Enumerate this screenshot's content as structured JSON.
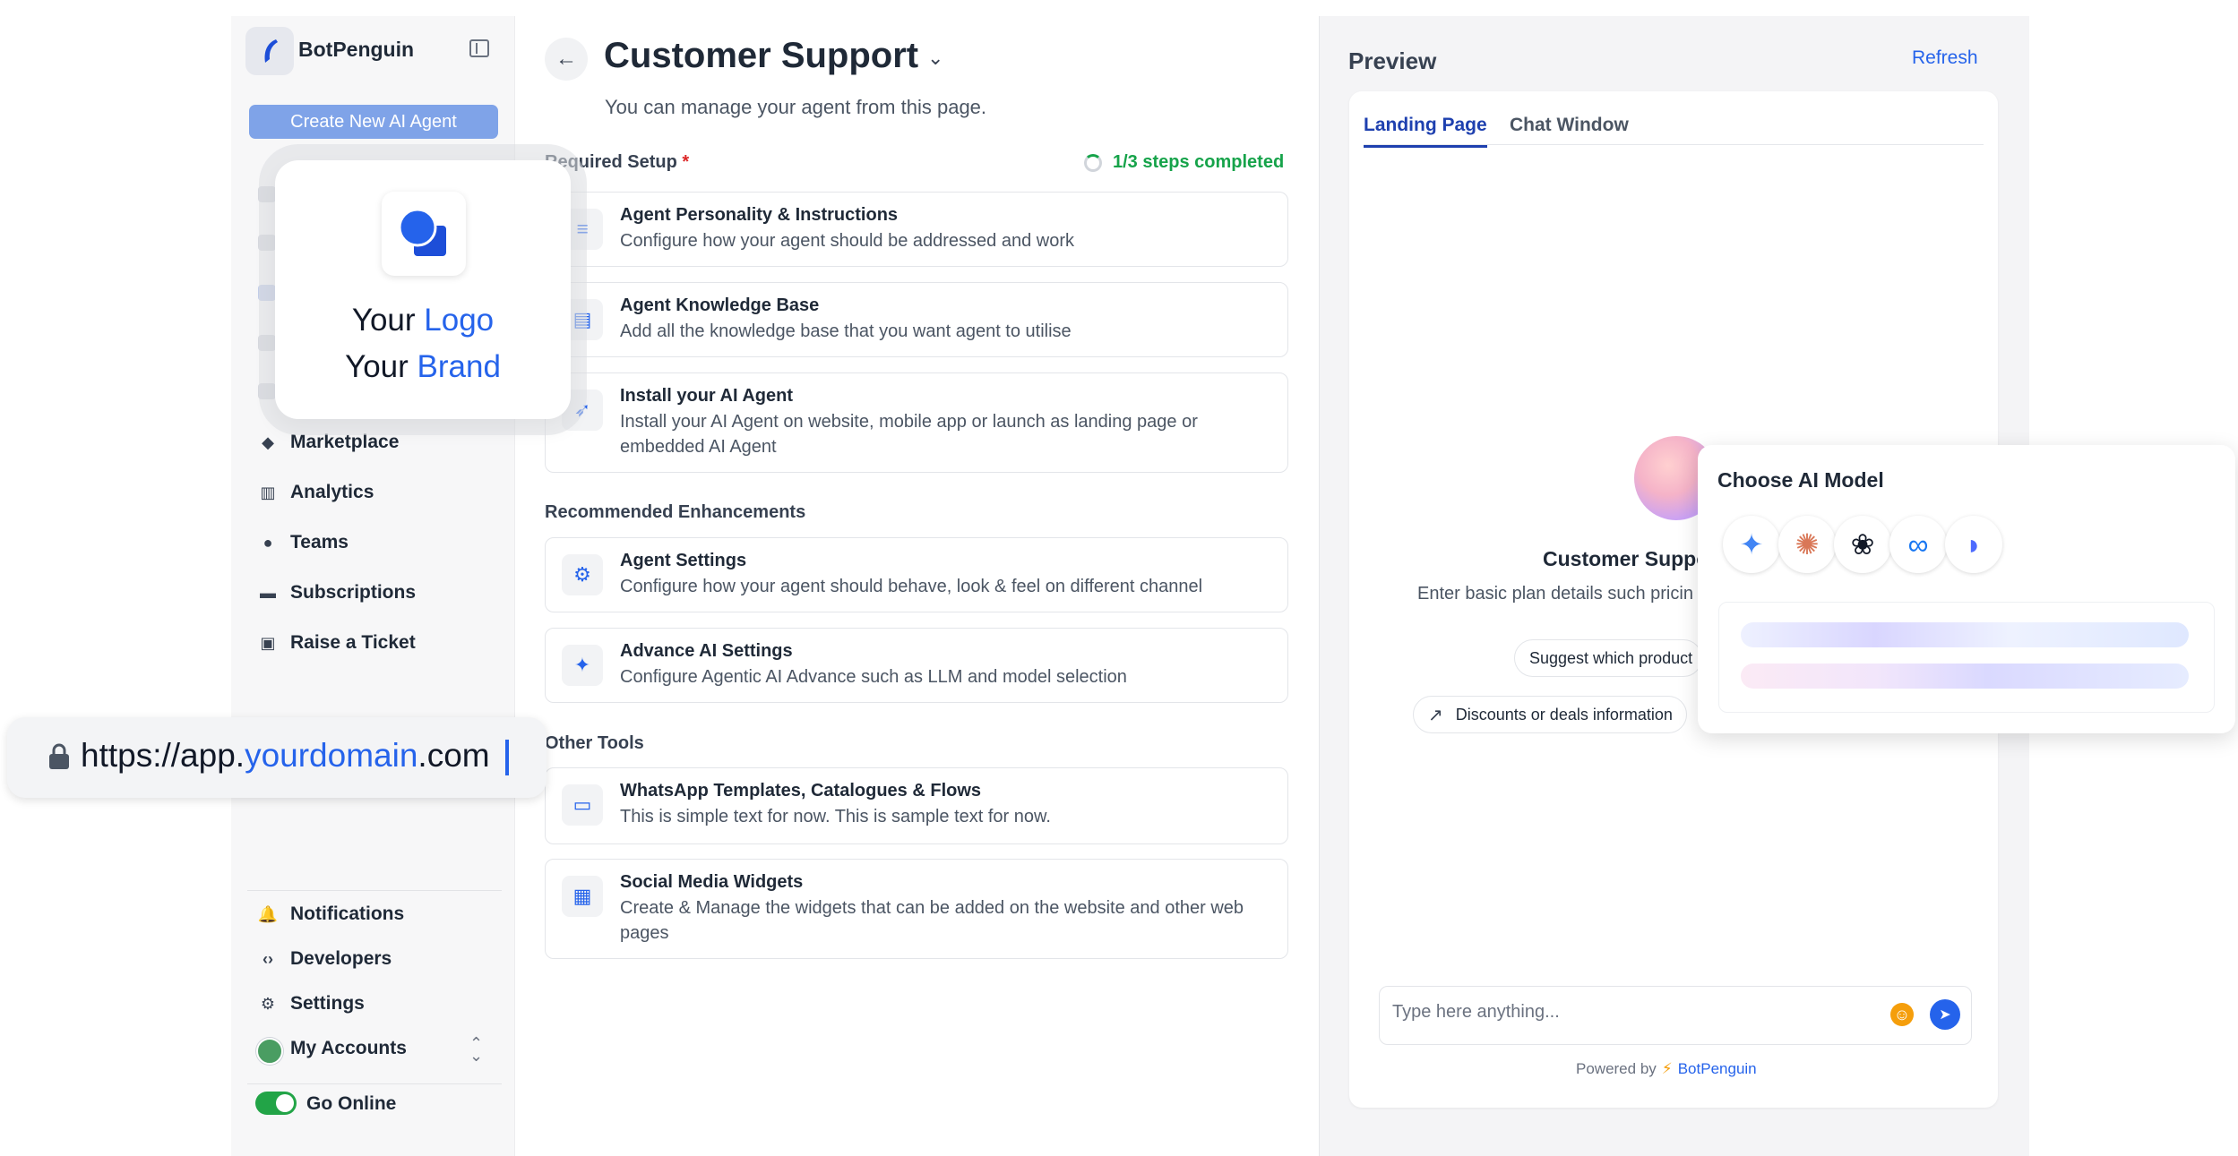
{
  "sidebar": {
    "brand": "BotPenguin",
    "create_button": "Create New AI Agent",
    "nav": [
      {
        "label": "Marketplace",
        "icon": "shapes-icon"
      },
      {
        "label": "Analytics",
        "icon": "bar-chart-icon"
      },
      {
        "label": "Teams",
        "icon": "people-icon"
      },
      {
        "label": "Subscriptions",
        "icon": "monitor-icon"
      },
      {
        "label": "Raise a Ticket",
        "icon": "ticket-icon"
      }
    ],
    "bottom": [
      {
        "label": "Notifications",
        "icon": "bell-icon"
      },
      {
        "label": "Developers",
        "icon": "code-icon"
      },
      {
        "label": "Settings",
        "icon": "gear-icon"
      },
      {
        "label": "My Accounts",
        "icon": "avatar"
      }
    ],
    "go_online": "Go Online"
  },
  "branding_overlay": {
    "line1_a": "Your",
    "line1_b": "Logo",
    "line2_a": "Your",
    "line2_b": "Brand"
  },
  "url_overlay": {
    "prefix": "https://app.",
    "domain": "yourdomain",
    "suffix": ".com"
  },
  "main": {
    "title": "Customer Support",
    "subtitle": "You can manage your agent from this page.",
    "required_label": "Required Setup",
    "required_star": "*",
    "steps": "1/3 steps completed",
    "required_cards": [
      {
        "title": "Agent Personality & Instructions",
        "desc": "Configure how your agent should be addressed and work",
        "icon": "text-lines-icon"
      },
      {
        "title": "Agent Knowledge Base",
        "desc": "Add all the knowledge base that you want agent to utilise",
        "icon": "book-icon"
      },
      {
        "title": "Install your AI Agent",
        "desc": "Install your AI Agent on website, mobile app or launch as landing page or embedded AI Agent",
        "icon": "rocket-icon"
      }
    ],
    "recommended_label": "Recommended Enhancements",
    "recommended_cards": [
      {
        "title": "Agent Settings",
        "desc": "Configure how your agent should behave, look & feel on different channel",
        "icon": "gear-icon"
      },
      {
        "title": "Advance AI Settings",
        "desc": "Configure Agentic AI Advance such as LLM and model selection",
        "icon": "sparkle-icon"
      }
    ],
    "other_label": "Other Tools",
    "other_cards": [
      {
        "title": "WhatsApp Templates, Catalogues & Flows",
        "desc": "This is simple text for now. This is sample text for now.",
        "icon": "template-icon"
      },
      {
        "title": "Social Media Widgets",
        "desc": "Create & Manage the widgets that can be added on the website and other web pages",
        "icon": "grid-icon"
      }
    ]
  },
  "preview": {
    "title": "Preview",
    "refresh": "Refresh",
    "tabs": [
      "Landing Page",
      "Chat Window"
    ],
    "bot_name": "Customer Suppo",
    "bot_desc": "Enter basic plan details such pricin",
    "chips": [
      "Suggest which product",
      "Discounts or deals information"
    ],
    "input_placeholder": "Type here anything...",
    "powered_by": "Powered by",
    "powered_brand": "BotPenguin"
  },
  "model_popup": {
    "title": "Choose AI Model",
    "models": [
      "gemini-icon",
      "claude-icon",
      "openai-icon",
      "meta-icon",
      "deepseek-icon"
    ]
  }
}
